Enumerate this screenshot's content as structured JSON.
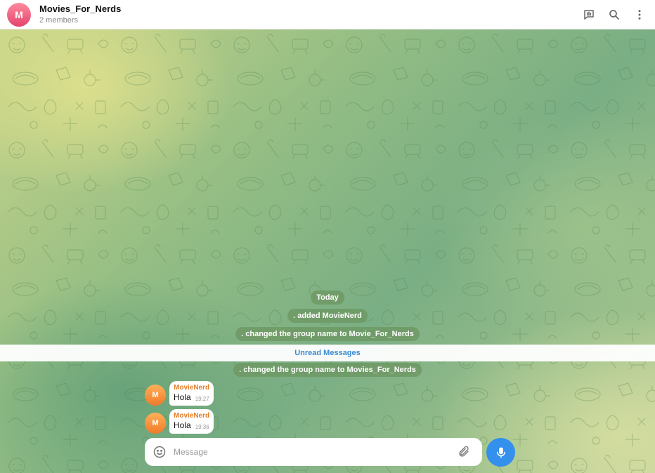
{
  "header": {
    "avatar_letter": "M",
    "title": "Movies_For_Nerds",
    "subtitle": "2 members",
    "actions": [
      {
        "icon": "chat-stats-icon"
      },
      {
        "icon": "search-icon"
      },
      {
        "icon": "more-vertical-icon"
      }
    ]
  },
  "service": {
    "date": "Today",
    "added_prefix": ". added ",
    "added_name": "MovieNerd",
    "rename1": ". changed the group name to Movie_For_Nerds",
    "unread": "Unread Messages",
    "rename2": ". changed the group name to Movies_For_Nerds"
  },
  "messages": [
    {
      "avatar_letter": "M",
      "sender": "MovieNerd",
      "text": "Hola",
      "time": "19:27"
    },
    {
      "avatar_letter": "M",
      "sender": "MovieNerd",
      "text": "Hola",
      "time": "19:36"
    }
  ],
  "composer": {
    "placeholder": "Message",
    "value": "",
    "emoji_icon": "smile-icon",
    "attach_icon": "paperclip-icon",
    "send_icon": "microphone-icon"
  },
  "colors": {
    "accent": "#3390ec",
    "avatar_group": "#e4456a",
    "avatar_user": "#f07a2a",
    "sender_name": "#e47e2a",
    "unread_text": "#3a8ad2"
  }
}
